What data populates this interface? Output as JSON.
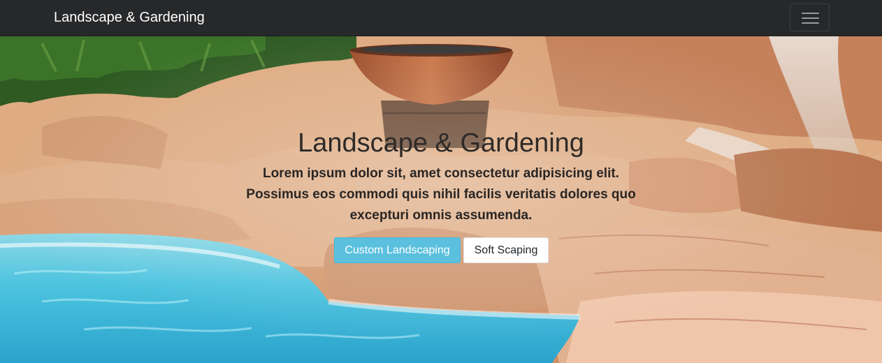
{
  "navbar": {
    "brand": "Landscape & Gardening",
    "toggler_icon": "hamburger-menu-icon"
  },
  "hero": {
    "title": "Landscape & Gardening",
    "lead": "Lorem ipsum dolor sit, amet consectetur adipisicing elit. Possimus eos commodi quis nihil facilis veritatis dolores quo excepturi omnis assumenda.",
    "buttons": [
      {
        "label": "Custom Landscaping",
        "style": "info",
        "color": "#5bc0de"
      },
      {
        "label": "Soft Scaping",
        "style": "light",
        "color": "#ffffff"
      }
    ],
    "background_image": "rock-waterfall-pool-with-copper-fire-bowl"
  },
  "colors": {
    "navbar_bg": "#27282a",
    "accent_info": "#5bc0de"
  }
}
